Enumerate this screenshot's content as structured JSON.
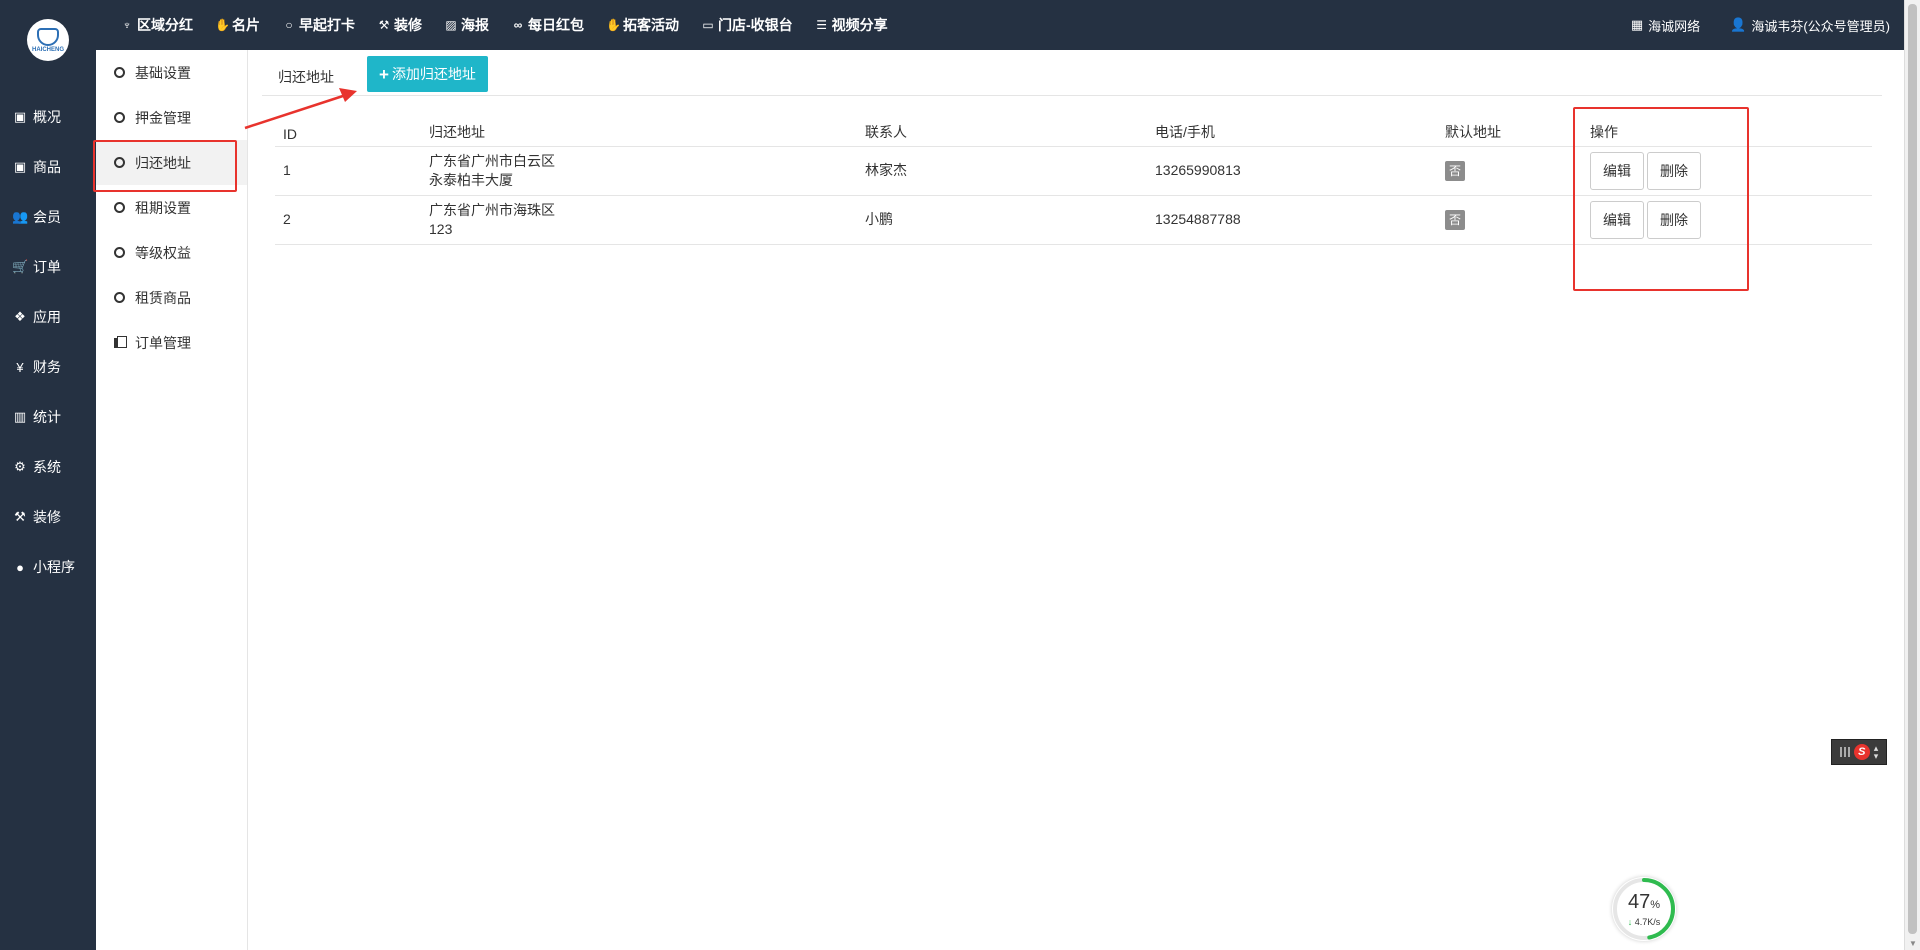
{
  "logo": {
    "text": "HAICHENG"
  },
  "topnav": [
    {
      "label": "区域分红",
      "icon": "tie-icon"
    },
    {
      "label": "名片",
      "icon": "card-icon"
    },
    {
      "label": "早起打卡",
      "icon": "circle-icon"
    },
    {
      "label": "装修",
      "icon": "hammer-icon"
    },
    {
      "label": "海报",
      "icon": "image-icon"
    },
    {
      "label": "每日红包",
      "icon": "link-icon"
    },
    {
      "label": "拓客活动",
      "icon": "handshake-icon"
    },
    {
      "label": "门店-收银台",
      "icon": "cash-icon"
    },
    {
      "label": "视频分享",
      "icon": "list-icon"
    }
  ],
  "topright": {
    "site_label": "海诚网络",
    "user_label": "海诚韦芬(公众号管理员)"
  },
  "sidebar": [
    {
      "label": "概况",
      "icon": "archive-icon"
    },
    {
      "label": "商品",
      "icon": "box-icon"
    },
    {
      "label": "会员",
      "icon": "users-icon"
    },
    {
      "label": "订单",
      "icon": "cart-icon"
    },
    {
      "label": "应用",
      "icon": "cubes-icon"
    },
    {
      "label": "财务",
      "icon": "yen-icon"
    },
    {
      "label": "统计",
      "icon": "bar-chart-icon"
    },
    {
      "label": "系统",
      "icon": "cogs-icon"
    },
    {
      "label": "装修",
      "icon": "hammer-icon"
    },
    {
      "label": "小程序",
      "icon": "wechat-icon"
    }
  ],
  "subnav": [
    {
      "label": "基础设置",
      "active": false
    },
    {
      "label": "押金管理",
      "active": false
    },
    {
      "label": "归还地址",
      "active": true
    },
    {
      "label": "租期设置",
      "active": false
    },
    {
      "label": "等级权益",
      "active": false
    },
    {
      "label": "租赁商品",
      "active": false
    },
    {
      "label": "订单管理",
      "active": false
    }
  ],
  "tabs": {
    "current": "归还地址",
    "add_label": "添加归还地址"
  },
  "table": {
    "headers": [
      "ID",
      "归还地址",
      "联系人",
      "电话/手机",
      "默认地址",
      "操作"
    ],
    "rows": [
      {
        "id": "1",
        "addr1": "广东省广州市白云区",
        "addr2": "永泰柏丰大厦",
        "contact": "林家杰",
        "phone": "13265990813",
        "default": "否"
      },
      {
        "id": "2",
        "addr1": "广东省广州市海珠区",
        "addr2": "123",
        "contact": "小鹏",
        "phone": "13254887788",
        "default": "否"
      }
    ],
    "edit_label": "编辑",
    "delete_label": "删除"
  },
  "speed_widget": {
    "percent": "47",
    "percent_sign": "%",
    "rate": "4.7K/s"
  },
  "colors": {
    "topbar": "#253142",
    "accent": "#1fb6c9",
    "highlight": "#e8332d"
  }
}
